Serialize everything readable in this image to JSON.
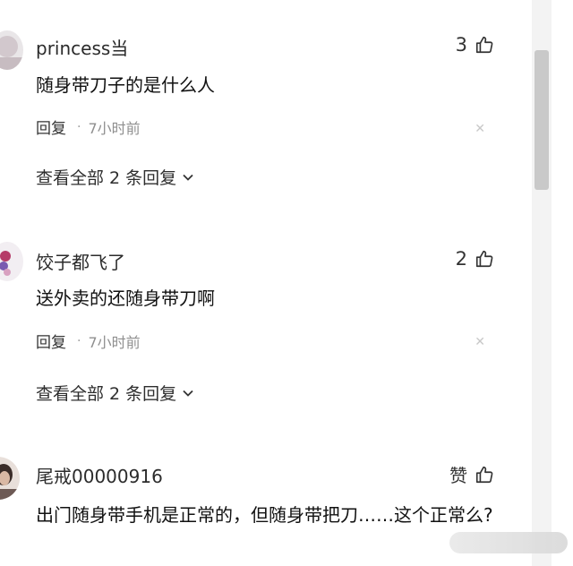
{
  "comments": [
    {
      "username": "princess当",
      "likes": "3",
      "content": "随身带刀子的是什么人",
      "reply_label": "回复",
      "time": "7小时前",
      "view_all": "查看全部 2 条回复"
    },
    {
      "username": "饺子都飞了",
      "likes": "2",
      "content": "送外卖的还随身带刀啊",
      "reply_label": "回复",
      "time": "7小时前",
      "view_all": "查看全部 2 条回复"
    },
    {
      "username": "尾戒00000916",
      "likes": "赞",
      "content": "出门随身带手机是正常的，但随身带把刀……这个正常么?"
    }
  ],
  "icons": {
    "like": "thumbs-up-icon",
    "chevron": "chevron-down-icon",
    "close": "close-icon"
  },
  "colors": {
    "text": "#1f1f1f",
    "muted": "#8f8f8f",
    "scroll_thumb": "#c9c9c9"
  }
}
